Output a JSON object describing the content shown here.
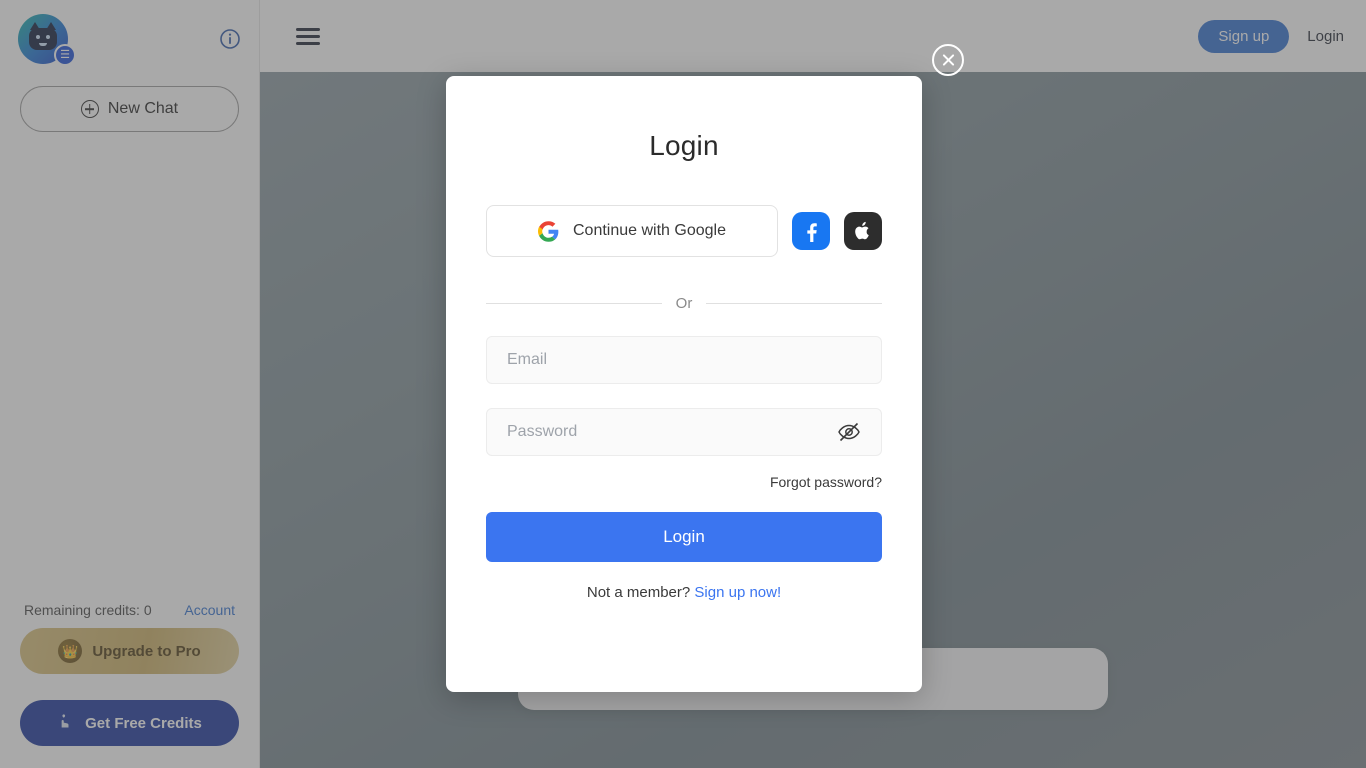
{
  "sidebar": {
    "logo_name": "robot-avatar",
    "info_icon": "info-icon",
    "new_chat_label": "New Chat",
    "credits_label": "Remaining credits: 0",
    "account_label": "Account",
    "upgrade_label": "Upgrade to Pro",
    "upgrade_icon": "crown-icon",
    "free_credits_label": "Get Free Credits",
    "free_credits_icon": "hand-heart-icon"
  },
  "topbar": {
    "menu_icon": "hamburger-menu-icon",
    "signup_label": "Sign up",
    "login_label": "Login"
  },
  "modal": {
    "close_icon": "close-circle-icon",
    "title": "Login",
    "google_label": "Continue with Google",
    "google_icon": "google-icon",
    "facebook_icon": "facebook-icon",
    "apple_icon": "apple-icon",
    "divider_label": "Or",
    "email": {
      "placeholder": "Email",
      "value": ""
    },
    "password": {
      "placeholder": "Password",
      "value": "",
      "toggle_icon": "eye-slash-icon"
    },
    "forgot_label": "Forgot password?",
    "submit_label": "Login",
    "member_prompt": "Not a member?",
    "signup_link_label": "Sign up now!"
  },
  "colors": {
    "primary_blue": "#3b75f0",
    "signup_blue": "#2f6fd0",
    "credits_blue": "#17349b",
    "pro_gold": "#cbae63",
    "facebook": "#1877f2",
    "apple": "#2d2d2d",
    "link": "#3b75f0"
  }
}
